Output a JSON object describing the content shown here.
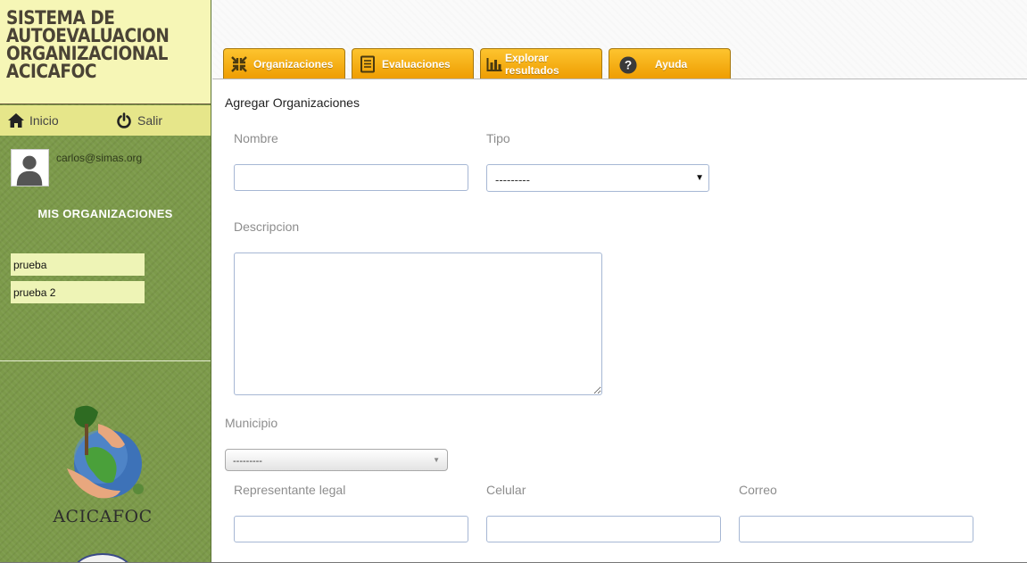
{
  "app": {
    "title_lines": [
      "SISTEMA DE",
      "AUTOEVALUACION",
      "ORGANIZACIONAL",
      "ACICAFOC"
    ]
  },
  "topnav": {
    "home_label": "Inicio",
    "logout_label": "Salir"
  },
  "user": {
    "email": "carlos@simas.org"
  },
  "sidebar": {
    "orgs_title": "MIS ORGANIZACIONES",
    "orgs": [
      {
        "label": "prueba"
      },
      {
        "label": "prueba 2"
      }
    ],
    "logo_text": "ACICAFOC"
  },
  "tabs": [
    {
      "label": "Organizaciones",
      "icon": "arrows-collapse-icon"
    },
    {
      "label": "Evaluaciones",
      "icon": "document-icon"
    },
    {
      "label": "Explorar resultados",
      "icon": "bar-chart-icon"
    },
    {
      "label": "Ayuda",
      "icon": "help-circle-icon"
    }
  ],
  "form": {
    "title": "Agregar Organizaciones",
    "nombre_label": "Nombre",
    "nombre_value": "",
    "tipo_label": "Tipo",
    "tipo_selected": "---------",
    "descripcion_label": "Descripcion",
    "descripcion_value": "",
    "municipio_label": "Municipio",
    "municipio_selected": "---------",
    "representante_label": "Representante legal",
    "celular_label": "Celular",
    "correo_label": "Correo"
  },
  "colors": {
    "tab_gradient_top": "#fdc42f",
    "tab_gradient_bottom": "#ee9c00",
    "sidebar_green": "#7c9a4a",
    "brand_bg": "#f6f6b6",
    "nav_bg": "#e6e68a",
    "org_item_bg": "#eef4b6"
  }
}
